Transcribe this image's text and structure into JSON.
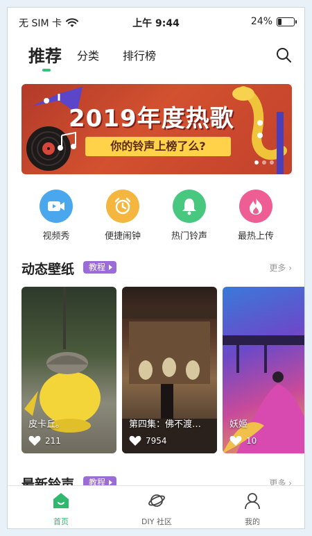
{
  "status_bar": {
    "carrier": "无 SIM 卡",
    "time": "上午 9:44",
    "battery": "24%",
    "battery_level": 0.24
  },
  "top_tabs": [
    {
      "label": "推荐",
      "active": true
    },
    {
      "label": "分类",
      "active": false
    },
    {
      "label": "排行榜",
      "active": false
    }
  ],
  "search": {
    "icon": "search-icon"
  },
  "banner": {
    "title": "2019年度热歌",
    "subtitle": "你的铃声上榜了么?",
    "page_count": 3,
    "active_page": 0
  },
  "quick_actions": [
    {
      "label": "视频秀",
      "icon": "video-icon",
      "color": "#4aa7ee"
    },
    {
      "label": "便捷闹钟",
      "icon": "alarm-clock-icon",
      "color": "#f4b63f"
    },
    {
      "label": "热门铃声",
      "icon": "bell-icon",
      "color": "#48c77f"
    },
    {
      "label": "最热上传",
      "icon": "fire-icon",
      "color": "#ee5e94"
    }
  ],
  "wallpaper_section": {
    "title": "动态壁纸",
    "badge": "教程",
    "more": "更多 ›",
    "cards": [
      {
        "name": "皮卡丘。",
        "likes": "211"
      },
      {
        "name": "第四集：佛不渡…",
        "likes": "7954"
      },
      {
        "name": "妖姬",
        "likes": "10"
      }
    ]
  },
  "ringtone_section": {
    "title": "最新铃声",
    "badge": "教程",
    "more": "更多 ›"
  },
  "bottom_nav": [
    {
      "label": "首页",
      "icon": "home-icon",
      "active": true
    },
    {
      "label": "DIY 社区",
      "icon": "planet-icon",
      "active": false
    },
    {
      "label": "我的",
      "icon": "user-icon",
      "active": false
    }
  ],
  "colors": {
    "accent": "#39c37a",
    "badge": "#9b6cd8"
  }
}
